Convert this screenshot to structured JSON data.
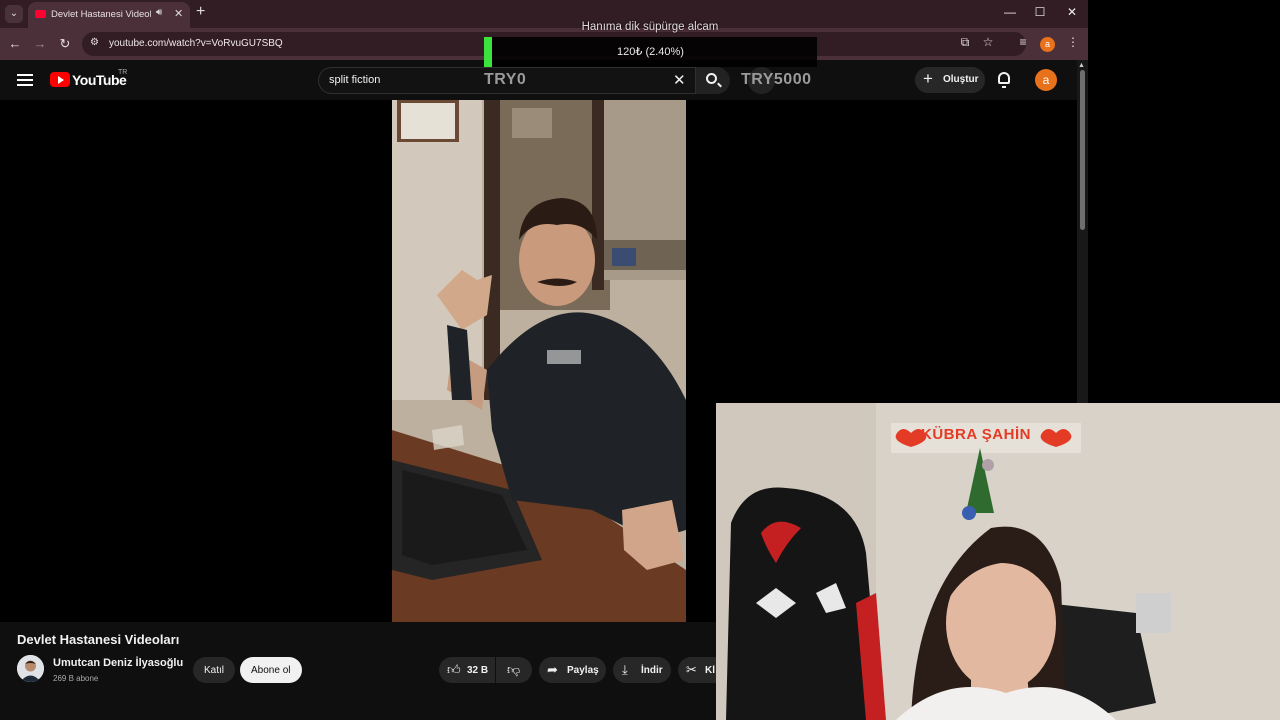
{
  "browser": {
    "tab_title": "Devlet Hastanesi Videoları",
    "url": "youtube.com/watch?v=VoRvuGU7SBQ",
    "profile_initial": "a"
  },
  "youtube": {
    "logo_text": "YouTube",
    "region": "TR",
    "search_value": "split fiction",
    "create_label": "Oluştur",
    "avatar_initial": "a"
  },
  "video": {
    "title": "Devlet Hastanesi Videoları",
    "channel_name": "Umutcan Deniz İlyasoğlu",
    "subscribers": "269 B abone",
    "join_label": "Katıl",
    "subscribe_label": "Abone ol",
    "like_count": "32 B",
    "share_label": "Paylaş",
    "download_label": "İndir",
    "clip_label": "Kl"
  },
  "overlay": {
    "goal_title": "Hanıma dik süpürge alcam",
    "progress_text": "120₺ (2.40%)",
    "progress_fraction": 0.024,
    "min_label": "TRY0",
    "max_label": "TRY5000",
    "bar_color": "#3ce33c"
  },
  "webcam": {
    "banner_text": "KÜBRA ŞAHİN"
  }
}
